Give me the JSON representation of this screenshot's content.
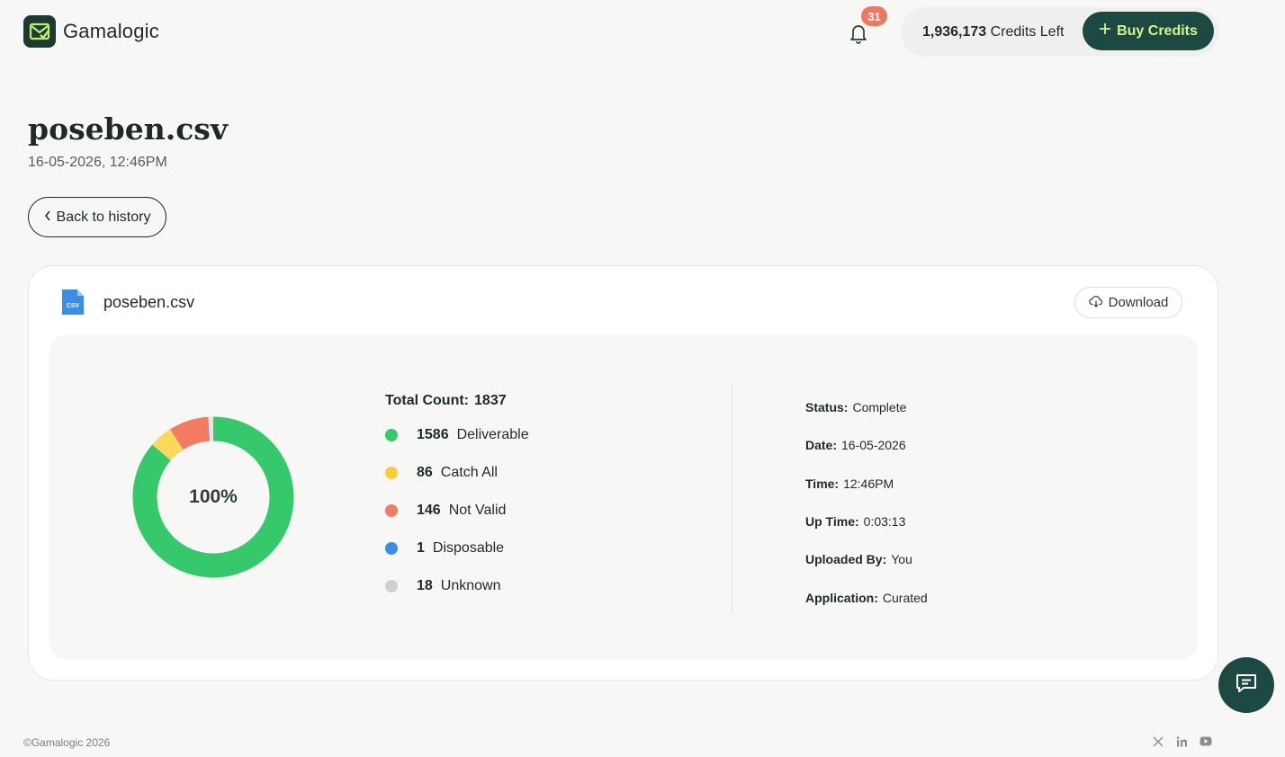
{
  "header": {
    "brand": "Gamalogic",
    "notifications_count": "31",
    "credits_amount": "1,936,173",
    "credits_suffix": "Credits Left",
    "buy_label": "Buy Credits"
  },
  "page": {
    "title": "poseben.csv",
    "subtitle": "16-05-2026, 12:46PM",
    "back_label": "Back to history"
  },
  "card": {
    "file_name": "poseben.csv",
    "file_badge": "CSV",
    "download_label": "Download",
    "center_label": "100%",
    "total_label": "Total Count:",
    "total_value": "1837",
    "stats": [
      {
        "count": "1586",
        "label": "Deliverable",
        "color": "#35c96b"
      },
      {
        "count": "86",
        "label": "Catch All",
        "color": "#f9cd36"
      },
      {
        "count": "146",
        "label": "Not Valid",
        "color": "#f47a62"
      },
      {
        "count": "1",
        "label": "Disposable",
        "color": "#3a8fe2"
      },
      {
        "count": "18",
        "label": "Unknown",
        "color": "#cfd1cf"
      }
    ],
    "details": [
      {
        "label": "Status:",
        "value": "Complete"
      },
      {
        "label": "Date:",
        "value": "16-05-2026"
      },
      {
        "label": "Time:",
        "value": "12:46PM"
      },
      {
        "label": "Up Time:",
        "value": "0:03:13"
      },
      {
        "label": "Uploaded By:",
        "value": "You"
      },
      {
        "label": "Application:",
        "value": "Curated"
      }
    ]
  },
  "chart_data": {
    "type": "pie",
    "categories": [
      "Deliverable",
      "Catch All",
      "Not Valid",
      "Disposable",
      "Unknown"
    ],
    "values": [
      1586,
      86,
      146,
      1,
      18
    ],
    "colors": [
      "#35c96b",
      "#fbd85c",
      "#f47a62",
      "#3a8fe2",
      "#e6e7e5"
    ],
    "donut": true,
    "center_text": "100%"
  },
  "footer": {
    "copyright": "©Gamalogic 2026"
  },
  "colors": {
    "brand_dark": "#1c4a42",
    "accent_lime": "#d9f48a",
    "badge_red": "#f07860"
  },
  "icons": [
    "logo-icon",
    "bell-icon",
    "plus-icon",
    "chevron-left-icon",
    "csv-file-icon",
    "cloud-download-icon",
    "chat-icon",
    "x-icon",
    "linkedin-icon",
    "youtube-icon"
  ]
}
